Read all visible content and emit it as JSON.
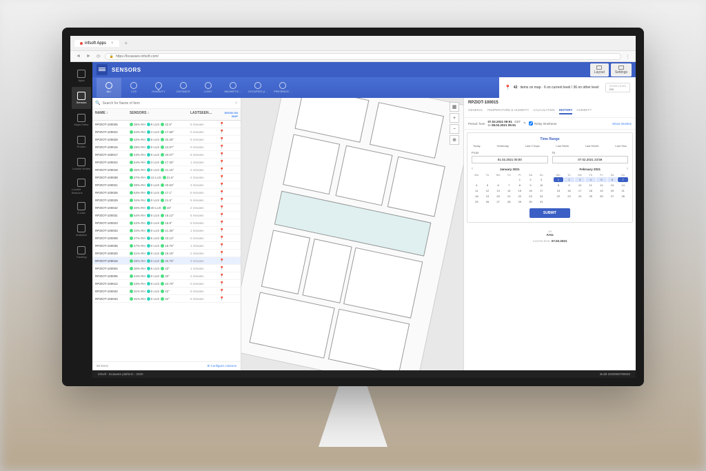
{
  "browser": {
    "tab_title": "infsoft Apps",
    "url": "https://locaware.infsoft.com/"
  },
  "rail": [
    "Apps",
    "Sensors",
    "Maps Editor",
    "Routes",
    "Locator Nodes",
    "Locator Beacons",
    "E-Inks",
    "Analytics",
    "Tracking"
  ],
  "header": {
    "title": "SENSORS",
    "layout": "Layout",
    "settings": "Settings"
  },
  "categories": [
    "ALL",
    "CO2",
    "HUMIDITY",
    "DISTANCE",
    "LIGHT",
    "MAGNETIC…",
    "OCCUPIED (I…",
    "PRESENCE…"
  ],
  "map": {
    "count": "42",
    "status_text": "items on map · 6 on current level / 36 on other level",
    "zoom_label": "ZOOM LEVEL",
    "zoom": "200"
  },
  "list": {
    "search_placeholder": "Search for Name of Item",
    "cols": [
      "NAME ↕",
      "SENSORS ↕",
      "LASTSEEN…"
    ],
    "show_on_map": "SHOW ON MAP",
    "footer_count": "50 items",
    "configure": "⚙ Configure columns",
    "rows": [
      {
        "name": "RPZIOT-100025",
        "hum": "35% RH",
        "lux": "9 LUX",
        "temp": "22.5°",
        "last": "5 minutes",
        "sel": false
      },
      {
        "name": "RPZIOT-100024",
        "hum": "54% RH",
        "lux": "4 LUX",
        "temp": "17.58°",
        "last": "0 minutes",
        "sel": false
      },
      {
        "name": "RPZIOT-100028",
        "hum": "42% RH",
        "lux": "0 LUX",
        "temp": "20.25°",
        "last": "5 minutes",
        "sel": false
      },
      {
        "name": "RPZIOT-100016",
        "hum": "28% RH",
        "lux": "0 LUX",
        "temp": "24.67°",
        "last": "0 minutes",
        "sel": false
      },
      {
        "name": "RPZIOT-100017",
        "hum": "43% RH",
        "lux": "0 LUX",
        "temp": "20.07°",
        "last": "5 minutes",
        "sel": false
      },
      {
        "name": "RPZIOT-100022",
        "hum": "54% RH",
        "lux": "3 LUX",
        "temp": "17.25°",
        "last": "1 minutes",
        "sel": false
      },
      {
        "name": "RPZIOT-100018",
        "hum": "36% RH",
        "lux": "0 LUX",
        "temp": "21.15°",
        "last": "2 minutes",
        "sel": false
      },
      {
        "name": "RPZIOT-100038",
        "hum": "27% RH",
        "lux": "12 LUX",
        "temp": "21.5°",
        "last": "2 minutes",
        "sel": false
      },
      {
        "name": "RPZIOT-100021",
        "hum": "39% RH",
        "lux": "0 LUX",
        "temp": "20.63°",
        "last": "3 minutes",
        "sel": false
      },
      {
        "name": "RPZIOT-100026",
        "hum": "53% RH",
        "lux": "0 LUX",
        "temp": "17.1°",
        "last": "5 minutes",
        "sel": false
      },
      {
        "name": "RPZIOT-100029",
        "hum": "34% RH",
        "lux": "0 LUX",
        "temp": "21.5°",
        "last": "5 minutes",
        "sel": false
      },
      {
        "name": "RPZIOT-100042",
        "hum": "40% RH",
        "lux": "40 LUX",
        "temp": "19°",
        "last": "2 minutes",
        "sel": false
      },
      {
        "name": "RPZIOT-100031",
        "hum": "54% RH",
        "lux": "0 LUX",
        "temp": "18.12°",
        "last": "5 minutes",
        "sel": false
      },
      {
        "name": "RPZIOT-100023",
        "hum": "42% RH",
        "lux": "0 LUX",
        "temp": "18.8°",
        "last": "5 minutes",
        "sel": false
      },
      {
        "name": "RPZIOT-100033",
        "hum": "34% RH",
        "lux": "0 LUX",
        "temp": "21.38°",
        "last": "1 minutes",
        "sel": false
      },
      {
        "name": "RPZIOT-100008",
        "hum": "27% RH",
        "lux": "5 LUX",
        "temp": "23.13°",
        "last": "0 minutes",
        "sel": false
      },
      {
        "name": "RPZIOT-100035",
        "hum": "47% RH",
        "lux": "0 LUX",
        "temp": "18.75°",
        "last": "1 minutes",
        "sel": false
      },
      {
        "name": "RPZIOT-100020",
        "hum": "41% RH",
        "lux": "0 LUX",
        "temp": "19.18°",
        "last": "2 minutes",
        "sel": false
      },
      {
        "name": "RPZIOT-100015",
        "hum": "28% RH",
        "lux": "0 LUX",
        "temp": "20.75°",
        "last": "3 minutes",
        "sel": true
      },
      {
        "name": "RPZIOT-100004",
        "hum": "30% RH",
        "lux": "6 LUX",
        "temp": "23°",
        "last": "1 minutes",
        "sel": false
      },
      {
        "name": "RPZIOT-100005",
        "hum": "44% RH",
        "lux": "0 LUX",
        "temp": "20°",
        "last": "2 minutes",
        "sel": false
      },
      {
        "name": "RPZIOT-100012",
        "hum": "23% RH",
        "lux": "0 LUX",
        "temp": "24.79°",
        "last": "0 minutes",
        "sel": false
      },
      {
        "name": "RPZIOT-100032",
        "hum": "31% RH",
        "lux": "0 LUX",
        "temp": "22°",
        "last": "5 minutes",
        "sel": false
      },
      {
        "name": "RPZIOT-100034",
        "hum": "31% RH",
        "lux": "0 LUX",
        "temp": "22°",
        "last": "5 minutes",
        "sel": false
      }
    ]
  },
  "detail": {
    "title": "RPZIOT-100015",
    "tabs": [
      "GENERAL",
      "TEMPERATURE & HUMIDITY",
      "CALCULATION",
      "HISTORY",
      "HUMIDITY"
    ],
    "period_label": "Period: from",
    "period_from": "07.02.2021 09:51",
    "period_to": "08.02.2021 09:51",
    "tz": "CET",
    "relay": "Relay timeframe",
    "show_timeline": "Show timeline",
    "meta": {
      "area_label": "on",
      "area_value": "Area",
      "current_label": "Current time:",
      "current_value": "07.02.2021"
    }
  },
  "range": {
    "title": "Time Range",
    "presets": [
      "Today",
      "Yesterday",
      "Last 3 Days",
      "Last Week",
      "Last Month",
      "Last Year"
    ],
    "from_label": "From",
    "from_value": "01.02.2021 00:00",
    "to_label": "To",
    "to_value": "07.02.2021 23:59",
    "submit": "SUBMIT",
    "dow": [
      "Mo",
      "Tu",
      "We",
      "Th",
      "Fr",
      "Sa",
      "Su"
    ],
    "cal1": {
      "month": "January 2021",
      "first_dow": 4,
      "days": 31,
      "sel": [],
      "range": []
    },
    "cal2": {
      "month": "February 2021",
      "first_dow": 0,
      "days": 28,
      "sel": [
        1,
        7
      ],
      "range": [
        2,
        3,
        4,
        5,
        6
      ]
    }
  },
  "footer": {
    "left": "infsoft - locaware platform - 2020",
    "right": "Build 2020060709032"
  }
}
